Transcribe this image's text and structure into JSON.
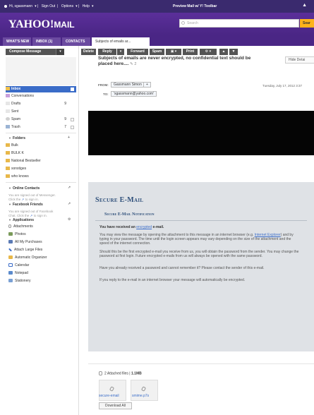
{
  "topbar": {
    "greeting": "Hi, sgassmann",
    "sign_out": "Sign Out",
    "options": "Options",
    "help": "Help",
    "promo": "Preview Mail w/ Y! Toolbar"
  },
  "masthead": {
    "logo_yahoo": "YAHOO!",
    "logo_mail": "MAIL",
    "search_placeholder": "Search",
    "search_button": "Sear"
  },
  "tabs": [
    {
      "label": "WHAT'S NEW"
    },
    {
      "label": "INBOX (1)"
    },
    {
      "label": "CONTACTS"
    },
    {
      "label": "Subjects of emails ar..."
    }
  ],
  "sidebar": {
    "compose": "Compose Message",
    "folders": [
      {
        "label": "Inbox",
        "count": ""
      },
      {
        "label": "Conversations",
        "count": ""
      },
      {
        "label": "Drafts",
        "count": "9"
      },
      {
        "label": "Sent",
        "count": ""
      },
      {
        "label": "Spam",
        "count": "9"
      },
      {
        "label": "Trash",
        "count": "7"
      }
    ],
    "folders_header": "Folders",
    "custom_folders": [
      {
        "label": "Bulk"
      },
      {
        "label": "BULK K"
      },
      {
        "label": "National Bestseller"
      },
      {
        "label": "sonstiges"
      },
      {
        "label": "who knows"
      }
    ],
    "online_contacts_header": "Online Contacts",
    "online_contacts_note_1": "You are signed out of Messenger.",
    "online_contacts_note_2": "Click the",
    "online_contacts_note_3": "to sign in.",
    "facebook_header": "Facebook Friends",
    "facebook_note_1": "You are signed out of Facebook",
    "facebook_note_2": "Chat. Click the",
    "facebook_note_3": "to sign in.",
    "applications_header": "Applications",
    "apps": [
      {
        "label": "Attachments",
        "icon": "paperclip-icon"
      },
      {
        "label": "Photos",
        "icon": "photos-icon"
      },
      {
        "label": "All My Purchases",
        "icon": "purchases-icon"
      },
      {
        "label": "Attach Large Files",
        "icon": "large-files-icon"
      },
      {
        "label": "Automatic Organizer",
        "icon": "organizer-icon"
      },
      {
        "label": "Calendar",
        "icon": "calendar-icon"
      },
      {
        "label": "Notepad",
        "icon": "notepad-icon"
      },
      {
        "label": "Stationery",
        "icon": "stationery-icon"
      }
    ]
  },
  "toolbar": {
    "delete": "Delete",
    "reply": "Reply",
    "forward": "Forward",
    "spam": "Spam",
    "print": "Print"
  },
  "message": {
    "subject": "Subjects of emails are never encrypted, no confidential text should be placed here....",
    "thread_count": "2",
    "hide_details": "Hide Detai",
    "from_label": "FROM:",
    "from_name": "Gassmann Simon",
    "to_label": "TO:",
    "to_address": "'sgassmann@yahoo.com'",
    "date": "Tuesday, July 17, 2012 3:37"
  },
  "secure": {
    "title": "Secure E-Mail",
    "subtitle": "Secure E-Mail Notification",
    "received_prefix": "You have received an",
    "received_link": "encrypted",
    "received_suffix": "e-mail.",
    "p1_a": "You may view the message by opening the attachment to this message in an internet browser (e.g.",
    "p1_link": "Internet Explorer",
    "p1_b": ") and by typing in your password. The time until the login screen appears may vary depending on the size of the attachment and the speed of the internet connection.",
    "p2": "Should this be the first encrypted e-mail you receive from us, you will obtain the password from the sender. You may change the password at first login. Future encrypted e-mails from us will always be opened with the same password.",
    "p3": "Have you already received a password and cannot remember it? Please contact the sender of this e-mail.",
    "p4": "If you reply to the e-mail in an internet browser your message will automatically be encrypted."
  },
  "attachments": {
    "count_label": "2 Attached files",
    "size": "1.1MB",
    "files": [
      {
        "name": "secure-email"
      },
      {
        "name": "smime.p7s"
      }
    ],
    "download_all": "Download All"
  },
  "colors": {
    "brand_purple": "#4a2685",
    "selected_blue": "#3a6cc8",
    "search_yellow": "#ffb31a"
  }
}
